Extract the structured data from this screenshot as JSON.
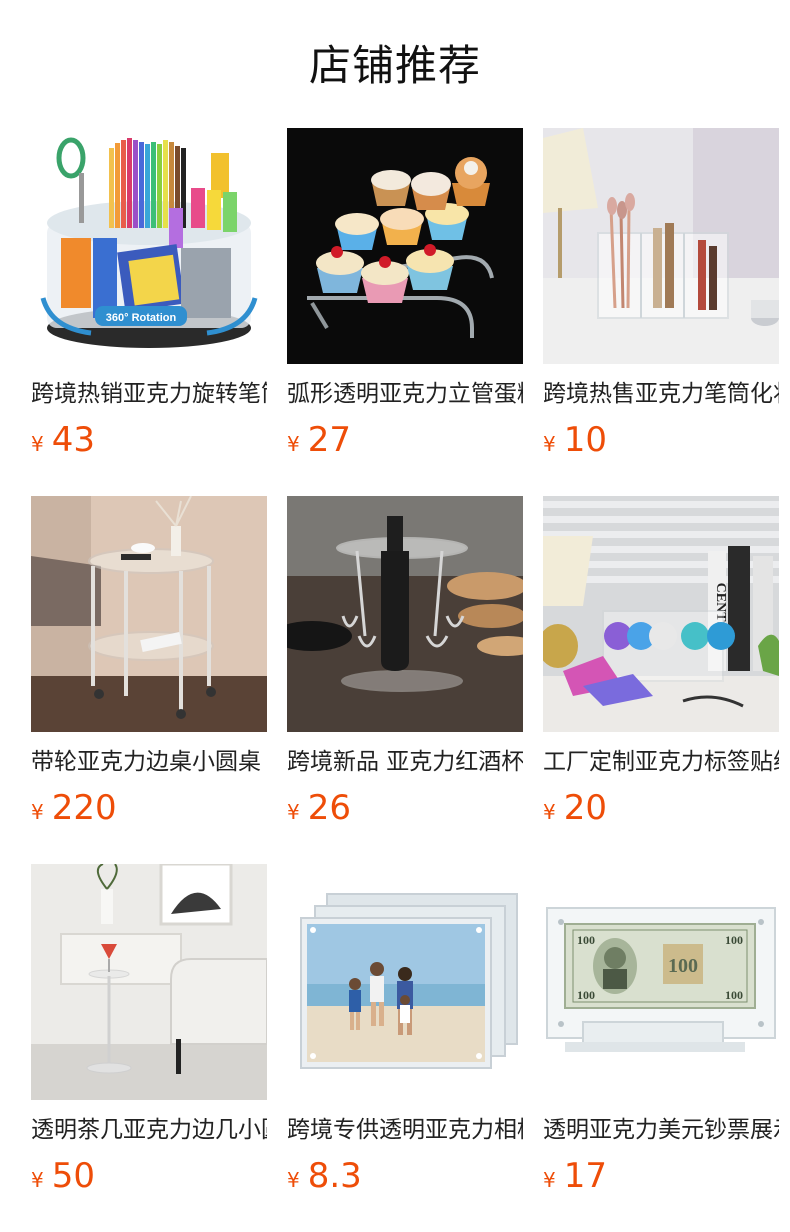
{
  "page": {
    "title": "店铺推荐"
  },
  "products": [
    {
      "name": "跨境热销亚克力旋转笔筒收纳盒",
      "currency": "¥",
      "price": "43",
      "image": "rotating-pen-organizer-photo"
    },
    {
      "name": "弧形透明亚克力立管蛋糕架",
      "currency": "¥",
      "price": "27",
      "image": "cupcake-stand-photo"
    },
    {
      "name": "跨境热售亚克力笔筒化妆刷收纳",
      "currency": "¥",
      "price": "10",
      "image": "makeup-brush-holder-photo"
    },
    {
      "name": "带轮亚克力边桌小圆桌",
      "currency": "¥",
      "price": "220",
      "image": "acrylic-side-cart-photo"
    },
    {
      "name": "跨境新品 亚克力红酒杯架",
      "currency": "¥",
      "price": "26",
      "image": "wine-glass-rack-photo"
    },
    {
      "name": "工厂定制亚克力标签贴纸收纳架",
      "currency": "¥",
      "price": "20",
      "image": "sticker-roll-holder-photo"
    },
    {
      "name": "透明茶几亚克力边几小圆桌",
      "currency": "¥",
      "price": "50",
      "image": "clear-side-table-photo"
    },
    {
      "name": "跨境专供透明亚克力相框",
      "currency": "¥",
      "price": "8.3",
      "image": "acrylic-photo-frame-photo"
    },
    {
      "name": "透明亚克力美元钞票展示框",
      "currency": "¥",
      "price": "17",
      "image": "dollar-bill-frame-photo"
    }
  ]
}
